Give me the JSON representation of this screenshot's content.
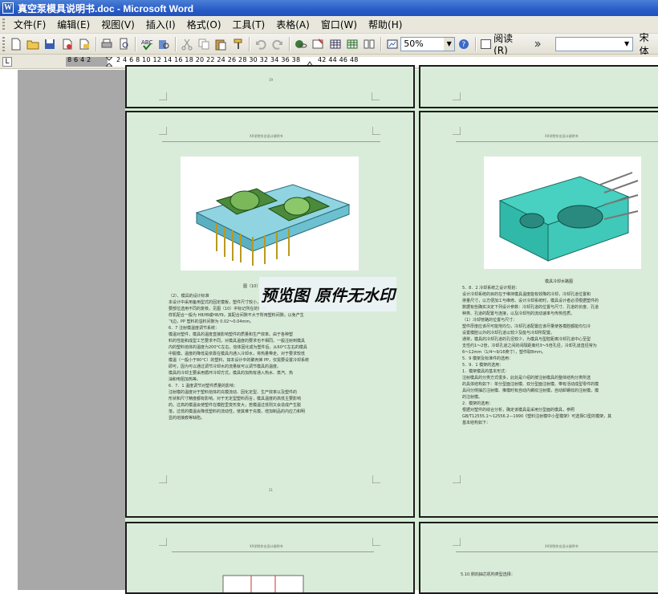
{
  "window": {
    "title": "真空泵模具说明书.doc - Microsoft Word"
  },
  "menu": [
    {
      "label": "文件(F)"
    },
    {
      "label": "编辑(E)"
    },
    {
      "label": "视图(V)"
    },
    {
      "label": "插入(I)"
    },
    {
      "label": "格式(O)"
    },
    {
      "label": "工具(T)"
    },
    {
      "label": "表格(A)"
    },
    {
      "label": "窗口(W)"
    },
    {
      "label": "帮助(H)"
    }
  ],
  "toolbar": {
    "zoom_value": "50%",
    "read_label": "阅读(R)",
    "font_name": "宋体",
    "icons": [
      "new-icon",
      "open-icon",
      "save-icon",
      "permission-icon",
      "email-icon",
      "print-icon",
      "print-preview-icon",
      "spelling-icon",
      "research-icon",
      "cut-icon",
      "copy-icon",
      "paste-icon",
      "format-painter-icon",
      "undo-icon",
      "redo-icon",
      "hyperlink-icon",
      "tables-borders-icon",
      "insert-table-icon",
      "insert-excel-icon",
      "columns-icon",
      "drawing-icon",
      "document-map-icon",
      "show-hide-icon",
      "help-icon"
    ]
  },
  "ruler": {
    "left_numbers": "8 6 4 2",
    "right_numbers": "2 4 6 8 10 12 14 16 18 20 22 24 26 28 30 32 34 36 38",
    "tail_numbers": "42 44 46 48"
  },
  "document": {
    "header_text": "XX学院毕业设计说明书",
    "page_numbers": {
      "top_left": "19",
      "mid_left": "21"
    },
    "left_page": {
      "figure_caption": "图（10）",
      "lines": [
        "（2）、模具的设计标准",
        "    本设计中采用备用型式的固定模板，塑件尺寸较小，采用一模两腔，结构",
        "要部位选用不同的复核，见图（10）中标记所在的位置。",
        "样机配合一般为 H8/f8或H8/f9，其配合间隙不大于所用塑料间隙，以免产生",
        "飞边，PP 塑料的溢料间隙为 0.02～0.04mm。",
        "6．7  注射模温度调节系统：",
        "    模温对塑件，模具的温度直接影响塑件的质量和生产效率。由于各种塑",
        "料的性能和成型工艺要求不同，对模具温度的要求也不相同。一般注射到模具",
        "内的塑料熔体的温度为200°C左右，熔体固化成为塑件后，从60°C左右的模具",
        "中脱模，温度的降低是依靠在模具内通入冷却水，将热量带走。对于要求较低",
        "模温（一般小于80°C）的塑料，如本设计中的聚丙烯 PP，仅需要设置冷却系统",
        "即可，因为可以通过调节冷却水的流量就可以调节模具的温度。",
        "    模具的冷却主要采用循环冷却方式，模具的加热有通入热水、蒸汽、热",
        "油和电阻加热等。",
        "6．7．1  温度调节对塑件质量的影响：",
        "    注射模的温度对于塑料熔体的充模流动、固化定型、生产效率以及塑件的",
        "形状和尺寸精度都有影响。对于无定型塑料而言，模具温度的高低主要影响",
        "的。过高的模温会使塑件在模腔里变形变大，若模温过低则又会造成产生脱",
        "落，过低的模温会降低塑料的流动性，使其难于充模，增加制品的内应力和明",
        "显的熔接痕等缺陷。"
      ]
    },
    "right_page": {
      "figure_caption": "模具冷却水路图",
      "lines": [
        "5．8．2  冷却系统之设计规划：",
        "    设计冷却系统的目的在于维持模具温度能有效降的冷却，冷却孔道位置和",
        "排量尺寸，以方便加工与维修。设计冷却系统时，模具设计者必须根据塑件的",
        "数据有些确实决定下列设计参数：冷却孔道的位置与尺寸、孔道的长度、孔道",
        "种类、孔道的配置与连接，以及冷却剂的流动速率与传热性质。",
        "（1）冷却管路的位置与尺寸：",
        "    塑件厚度应该尽可能地均匀，冷却孔道配置应该尽量使各模腔都能均匀冷",
        "设置模腔以外的冷却孔道以较少及能与冷却所配置。",
        "    通常，模具的冷却孔道的孔径较少，为模具与型腔距离冷却孔道中心至型",
        "支性约1～2倍，冷却孔道之间的间隔距离约3～5倍孔径，冷却孔道直径常为",
        "6～12mm（1/4～9/16英寸），塑件取8mm。",
        "5．9  模架及标准件的选用：",
        "5．9．1  模架的选用：",
        "1．模架模具的基本形式：",
        "    注射模具的分类方式很多，此处是介绍的按注射模具的整体结构分类所选",
        "的具体结构如下：单分型面注射模、双分型面注射模、带有活动成型零件的模",
        "具间分侧抽芯注射模、推模时有自动内螺纹注射模，自动卸螺纹的注射模，模",
        "的注射模。",
        "2．模架的选用：",
        "    根据对塑件的综合分析，确定该模具是采用分型面的模具，参照",
        "GB/T12555.1～12556.2—1990《塑料注射模中小型模架》可选择CI型的模架，其",
        "基本结构如下："
      ]
    },
    "bottom_right_text": "5.10.侧向抽芯机构类型选择："
  },
  "watermark": {
    "text": "预览图 原件无水印"
  }
}
